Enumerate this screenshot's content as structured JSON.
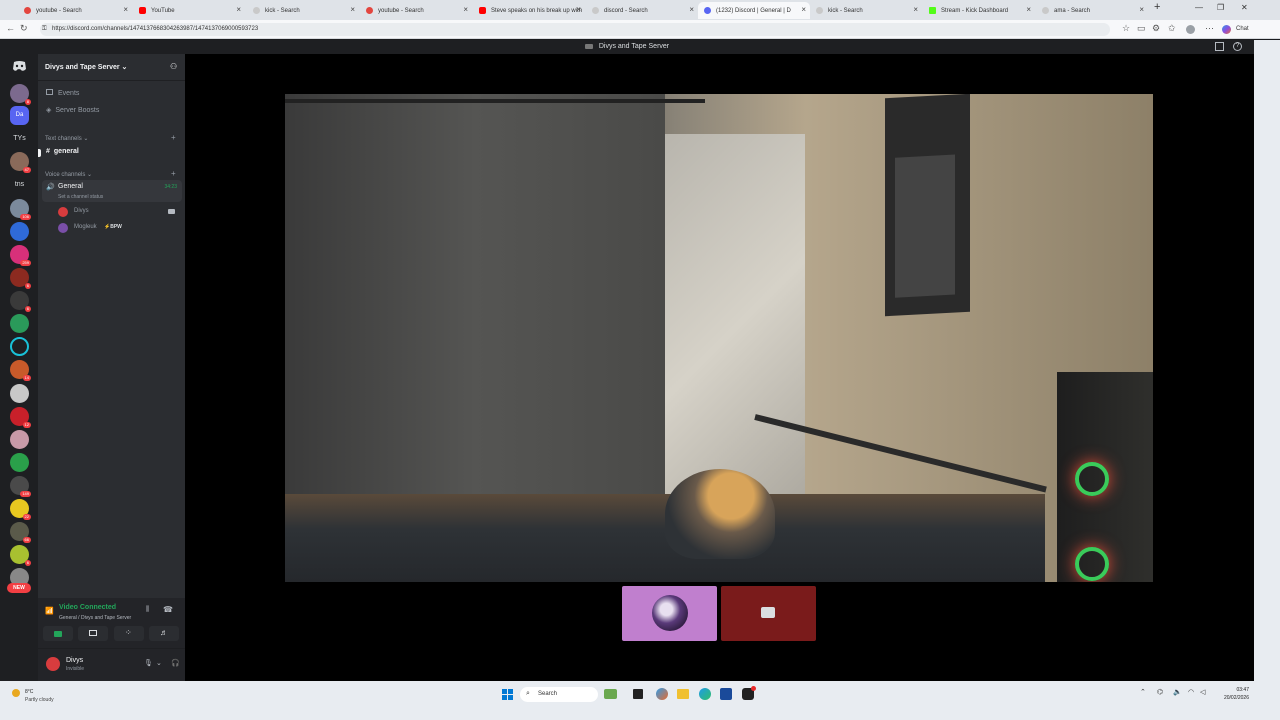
{
  "browser": {
    "tabs": [
      {
        "title": "youtube - Search",
        "color": "#e3463f"
      },
      {
        "title": "YouTube",
        "color": "#ff0000"
      },
      {
        "title": "kick - Search",
        "color": "#8a8a8a"
      },
      {
        "title": "youtube - Search",
        "color": "#e3463f"
      },
      {
        "title": "Steve speaks on his break up with",
        "color": "#ff0000"
      },
      {
        "title": "discord - Search",
        "color": "#8a8a8a"
      },
      {
        "title": "(1232) Discord | General | D",
        "color": "#5865f2"
      },
      {
        "title": "kick - Search",
        "color": "#8a8a8a"
      },
      {
        "title": "Stream - Kick Dashboard",
        "color": "#53fc18"
      },
      {
        "title": "ama - Search",
        "color": "#8a8a8a"
      }
    ],
    "url": "https://discord.com/channels/1474137668304263987/1474137069000593723",
    "chat_label": "Chat"
  },
  "discord": {
    "window_title": "Divys and Tape Server",
    "server_name": "Divys and Tape Server",
    "menu": {
      "events": "Events",
      "boosts": "Server Boosts"
    },
    "text_category": "Text channels",
    "text_channel": "general",
    "voice_category": "Voice channels",
    "voice_channel": "General",
    "voice_timer": "34:23",
    "voice_status": "Set a channel status",
    "members": [
      {
        "name": "Divys"
      },
      {
        "name": "Mogleuk",
        "tag": "BPW"
      }
    ],
    "guild_labels": {
      "ty": "TYs",
      "tns": "tns",
      "new": "NEW"
    },
    "guild_badges": [
      "8",
      "",
      "",
      "",
      "",
      "",
      "6",
      "106",
      "",
      "",
      "259",
      "",
      "",
      "",
      "",
      "",
      "",
      "",
      "6",
      "",
      "",
      "",
      "10",
      "",
      "",
      "",
      "",
      "",
      "",
      "12",
      "",
      "",
      "",
      "18",
      "149",
      "6",
      "22",
      "",
      "66",
      "6",
      ""
    ],
    "voice_panel": {
      "status": "Video Connected",
      "location": "General / Divys and Tape Server"
    },
    "user": {
      "name": "Divys",
      "status": "Invisible"
    }
  },
  "taskbar": {
    "weather_temp": "8°C",
    "weather_desc": "Partly cloudy",
    "search": "Search",
    "time": "03:47",
    "date": "20/02/2026"
  }
}
